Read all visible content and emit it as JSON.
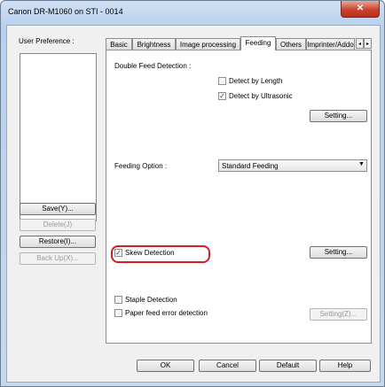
{
  "window": {
    "title": "Canon DR-M1060 on STI - 0014",
    "close_glyph": "✕"
  },
  "left": {
    "label": "User Preference :",
    "buttons": {
      "save": "Save(Y)...",
      "delete": "Delete(J)",
      "restore": "Restore(I)...",
      "backup": "Back Up(X)..."
    }
  },
  "tabs": [
    "Basic",
    "Brightness",
    "Image processing",
    "Feeding",
    "Others",
    "Imprinter/Addo"
  ],
  "tab_scroll": {
    "left": "◂",
    "right": "▸"
  },
  "feeding": {
    "double_feed_label": "Double Feed Detection :",
    "detect_by_length": "Detect by Length",
    "detect_by_ultrasonic": "Detect by Ultrasonic",
    "setting1": "Setting...",
    "feeding_option_label": "Feeding Option :",
    "feeding_option_value": "Standard Feeding",
    "skew_detection": "Skew Detection",
    "setting2": "Setting...",
    "staple_detection": "Staple Detection",
    "paper_feed_error": "Paper feed error detection",
    "setting3": "Setting(Z)..."
  },
  "checks": {
    "length": false,
    "ultrasonic": true,
    "skew": true,
    "staple": false,
    "paper": false
  },
  "footer": {
    "ok": "OK",
    "cancel": "Cancel",
    "default": "Default",
    "help": "Help"
  }
}
